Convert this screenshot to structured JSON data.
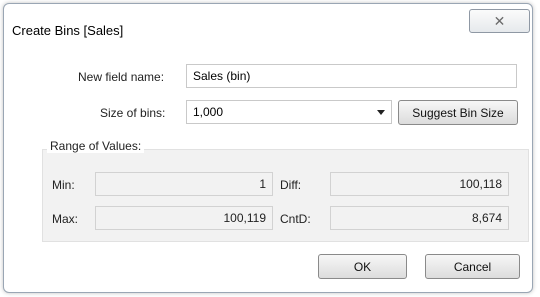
{
  "window": {
    "title": "Create Bins [Sales]",
    "close_glyph": "✕",
    "close_icon": "close-icon"
  },
  "form": {
    "field_name_label": "New field name:",
    "field_name_value": "Sales (bin)",
    "bin_size_label": "Size of bins:",
    "bin_size_value": "1,000",
    "suggest_button": "Suggest Bin Size"
  },
  "range": {
    "group_title": "Range of Values:",
    "min_label": "Min:",
    "min_value": "1",
    "diff_label": "Diff:",
    "diff_value": "100,118",
    "max_label": "Max:",
    "max_value": "100,119",
    "cntd_label": "CntD:",
    "cntd_value": "8,674"
  },
  "footer": {
    "ok_label": "OK",
    "cancel_label": "Cancel"
  }
}
